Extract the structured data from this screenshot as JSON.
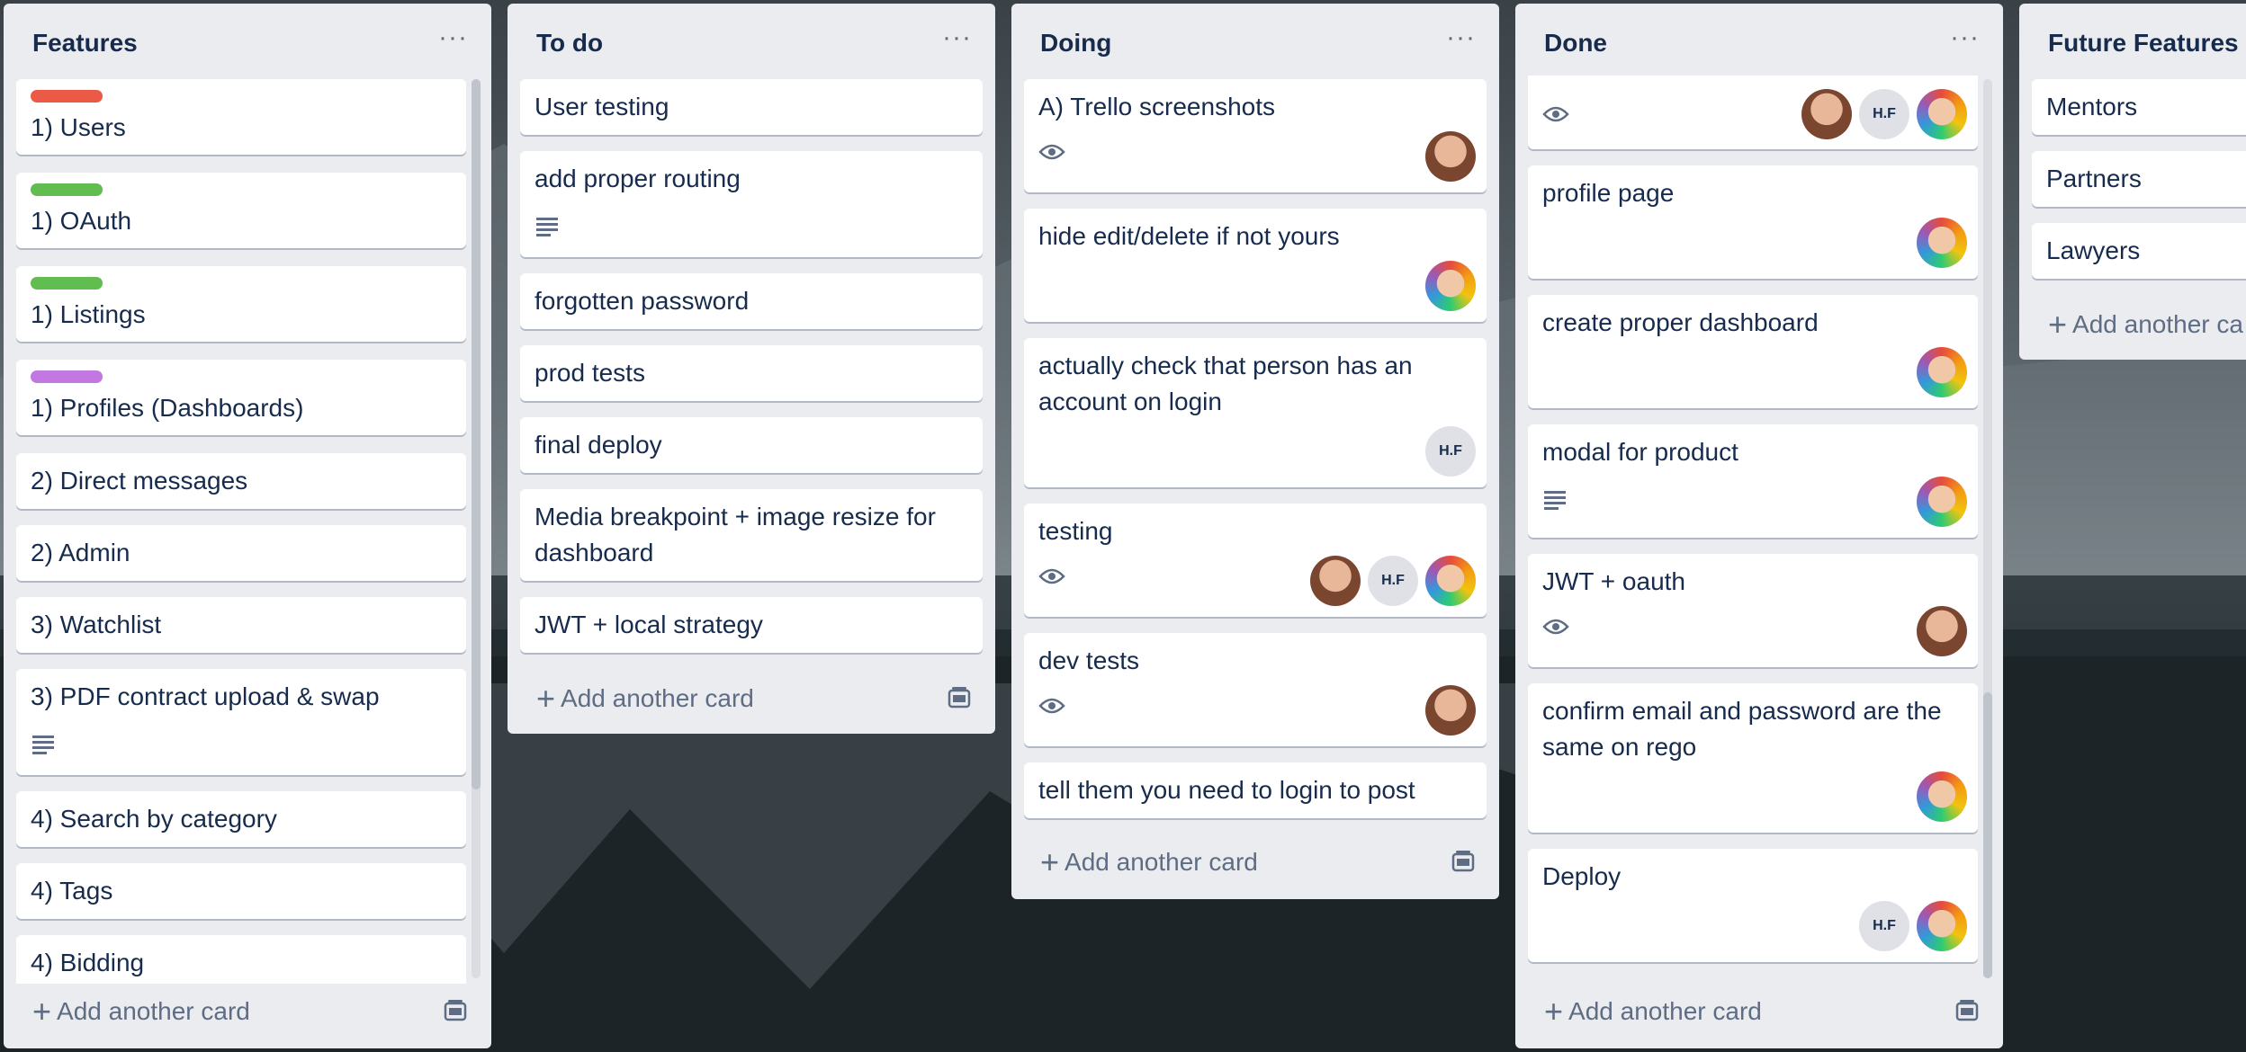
{
  "lists": [
    {
      "title": "Features",
      "cards": [
        {
          "title": "1) Users",
          "label_color": "#eb5a46"
        },
        {
          "title": "1) OAuth",
          "label_color": "#61bd4f"
        },
        {
          "title": "1) Listings",
          "label_color": "#61bd4f"
        },
        {
          "title": "1) Profiles (Dashboards)",
          "label_color": "#c377e0"
        },
        {
          "title": "2) Direct messages"
        },
        {
          "title": "2) Admin"
        },
        {
          "title": "3) Watchlist"
        },
        {
          "title": "3) PDF contract upload & swap",
          "badges": [
            "description-icon"
          ]
        },
        {
          "title": "4) Search by category"
        },
        {
          "title": "4) Tags"
        },
        {
          "title": "4) Bidding"
        }
      ],
      "add_label": "Add another card"
    },
    {
      "title": "To do",
      "cards": [
        {
          "title": "User testing"
        },
        {
          "title": "add proper routing",
          "badges": [
            "description-icon"
          ]
        },
        {
          "title": "forgotten password"
        },
        {
          "title": "prod tests"
        },
        {
          "title": "final deploy"
        },
        {
          "title": "Media breakpoint + image resize for dashboard"
        },
        {
          "title": "JWT + local strategy"
        }
      ],
      "add_label": "Add another card"
    },
    {
      "title": "Doing",
      "cards": [
        {
          "title": "A) Trello screenshots",
          "badges": [
            "watch-icon"
          ],
          "members": [
            "photo-a"
          ]
        },
        {
          "title": "hide edit/delete if not yours",
          "members": [
            "photo-b"
          ]
        },
        {
          "title": "actually check that person has an account on login",
          "members": [
            "H.F"
          ]
        },
        {
          "title": "testing",
          "badges": [
            "watch-icon"
          ],
          "members": [
            "photo-a",
            "H.F",
            "photo-b"
          ]
        },
        {
          "title": "dev tests",
          "badges": [
            "watch-icon"
          ],
          "members": [
            "photo-a"
          ]
        },
        {
          "title": "tell them you need to login to post"
        }
      ],
      "add_label": "Add another card"
    },
    {
      "title": "Done",
      "cards": [
        {
          "title": "",
          "badges": [
            "watch-icon"
          ],
          "members": [
            "photo-a",
            "H.F",
            "photo-b"
          ]
        },
        {
          "title": "profile page",
          "members": [
            "photo-b"
          ]
        },
        {
          "title": "create proper dashboard",
          "members": [
            "photo-b"
          ]
        },
        {
          "title": "modal for product",
          "badges": [
            "description-icon"
          ],
          "members": [
            "photo-b"
          ]
        },
        {
          "title": "JWT + oauth",
          "badges": [
            "watch-icon"
          ],
          "members": [
            "photo-a"
          ]
        },
        {
          "title": "confirm email and password are the same on rego",
          "members": [
            "photo-b"
          ]
        },
        {
          "title": "Deploy",
          "members": [
            "H.F",
            "photo-b"
          ]
        }
      ],
      "add_label": "Add another card"
    },
    {
      "title": "Future Features",
      "cards": [
        {
          "title": "Mentors"
        },
        {
          "title": "Partners"
        },
        {
          "title": "Lawyers"
        }
      ],
      "add_label": "Add another ca"
    }
  ]
}
